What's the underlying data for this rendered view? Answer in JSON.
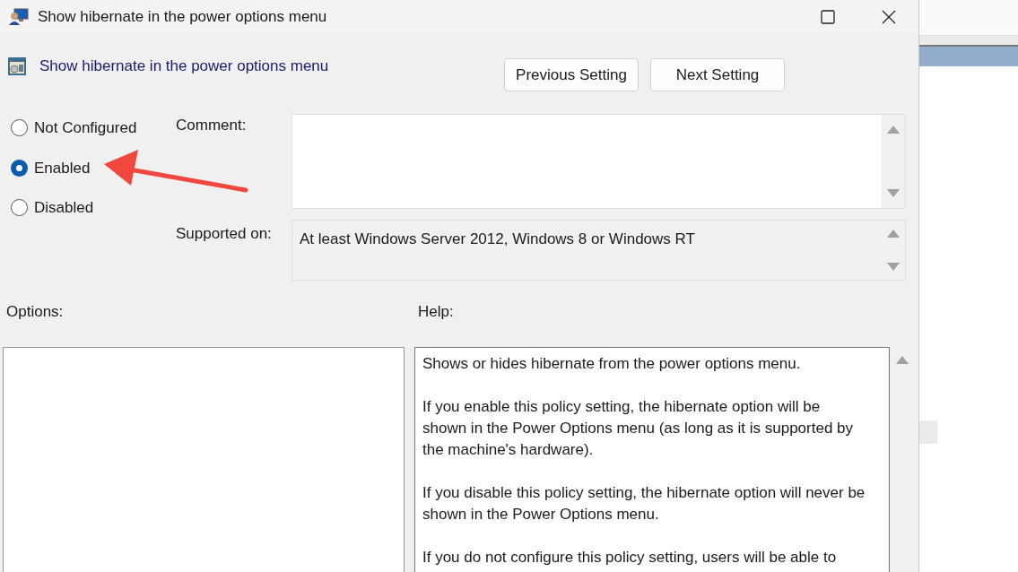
{
  "window": {
    "title": "Show hibernate in the power options menu"
  },
  "setting": {
    "title": "Show hibernate in the power options menu"
  },
  "buttons": [
    "Previous Setting",
    "Next Setting"
  ],
  "states": [
    {
      "label": "Not Configured",
      "selected": false
    },
    {
      "label": "Enabled",
      "selected": true
    },
    {
      "label": "Disabled",
      "selected": false
    }
  ],
  "comment": {
    "label": "Comment:"
  },
  "supported_on": {
    "label": "Supported on:",
    "value": "At least Windows Server 2012, Windows 8 or Windows RT"
  },
  "options": {
    "label": "Options:"
  },
  "help": {
    "label": "Help:",
    "paragraphs": [
      "Shows or hides hibernate from the power options menu.",
      "If you enable this policy setting, the hibernate option will be shown in the Power Options menu (as long as it is supported by the machine's hardware).",
      "If you disable this policy setting, the hibernate option will never be shown in the Power Options menu.",
      "If you do not configure this policy setting, users will be able to"
    ]
  }
}
